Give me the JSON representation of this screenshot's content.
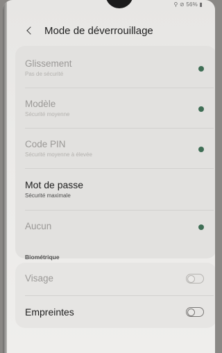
{
  "status_bar": {
    "battery_text": "56%"
  },
  "header": {
    "title": "Mode de déverrouillage"
  },
  "options": [
    {
      "label": "Glissement",
      "sub": "Pas de sécurité",
      "icon": "info-icon"
    },
    {
      "label": "Modèle",
      "sub": "Sécurité moyenne",
      "icon": "info-icon"
    },
    {
      "label": "Code PIN",
      "sub": "Sécurité moyenne à élevée",
      "icon": "info-icon"
    },
    {
      "label": "Mot de passe",
      "sub": "Sécurité maximale",
      "icon": null
    },
    {
      "label": "Aucun",
      "sub": "",
      "icon": "info-icon"
    }
  ],
  "biometrics": {
    "section_label": "Biométrique",
    "items": [
      {
        "label": "Visage",
        "enabled": false
      },
      {
        "label": "Empreintes",
        "enabled": false
      }
    ]
  },
  "colors": {
    "info_icon": "#3f6e55",
    "background": "#ebeae8",
    "text_active": "#1d1d1d"
  }
}
